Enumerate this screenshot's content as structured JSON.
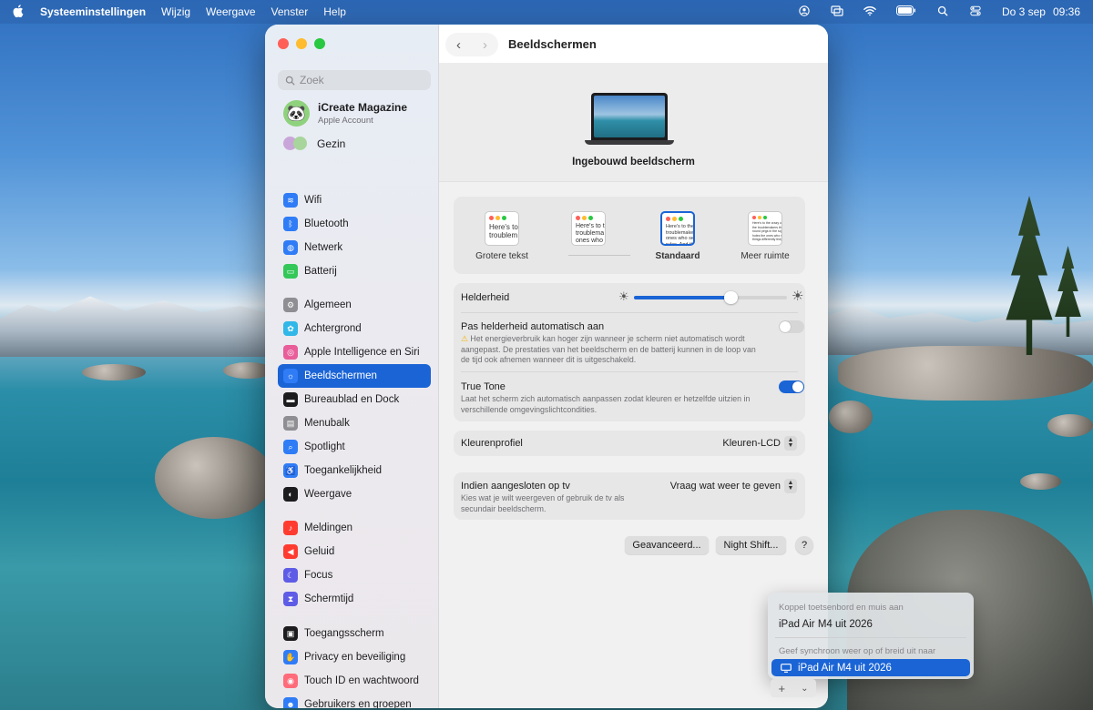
{
  "menubar": {
    "app": "Systeeminstellingen",
    "menus": [
      "Wijzig",
      "Weergave",
      "Venster",
      "Help"
    ],
    "date": "Do 3 sep",
    "time": "09:36"
  },
  "sidebar": {
    "search_placeholder": "Zoek",
    "account": {
      "name": "iCreate Magazine",
      "subtitle": "Apple Account"
    },
    "family": "Gezin",
    "groups": [
      [
        {
          "label": "Wifi",
          "icon": "wifi-icon",
          "color": "#2f7cf6"
        },
        {
          "label": "Bluetooth",
          "icon": "bluetooth-icon",
          "color": "#2f7cf6"
        },
        {
          "label": "Netwerk",
          "icon": "globe-icon",
          "color": "#2f7cf6"
        },
        {
          "label": "Batterij",
          "icon": "battery-icon",
          "color": "#34c759"
        }
      ],
      [
        {
          "label": "Algemeen",
          "icon": "gear-icon",
          "color": "#8e8e93"
        },
        {
          "label": "Achtergrond",
          "icon": "wallpaper-icon",
          "color": "#31b7e8"
        },
        {
          "label": "Apple Intelligence en Siri",
          "icon": "siri-icon",
          "color": "#e85d9a"
        },
        {
          "label": "Beeldschermen",
          "icon": "display-icon",
          "color": "#2f7cf6"
        },
        {
          "label": "Bureaublad en Dock",
          "icon": "dock-icon",
          "color": "#1c1c1e"
        },
        {
          "label": "Menubalk",
          "icon": "menubar-icon",
          "color": "#8e8e93"
        },
        {
          "label": "Spotlight",
          "icon": "search-icon",
          "color": "#2f7cf6"
        },
        {
          "label": "Toegankelijkheid",
          "icon": "accessibility-icon",
          "color": "#2f7cf6"
        },
        {
          "label": "Weergave",
          "icon": "appearance-icon",
          "color": "#1c1c1e"
        }
      ],
      [
        {
          "label": "Meldingen",
          "icon": "bell-icon",
          "color": "#ff3b30"
        },
        {
          "label": "Geluid",
          "icon": "speaker-icon",
          "color": "#ff3b30"
        },
        {
          "label": "Focus",
          "icon": "moon-icon",
          "color": "#5e5ce6"
        },
        {
          "label": "Schermtijd",
          "icon": "hourglass-icon",
          "color": "#5e5ce6"
        }
      ],
      [
        {
          "label": "Toegangsscherm",
          "icon": "lock-icon",
          "color": "#1c1c1e"
        },
        {
          "label": "Privacy en beveiliging",
          "icon": "hand-icon",
          "color": "#2f7cf6"
        },
        {
          "label": "Touch ID en wachtwoord",
          "icon": "fingerprint-icon",
          "color": "#ff6b7a"
        },
        {
          "label": "Gebruikers en groepen",
          "icon": "users-icon",
          "color": "#2f7cf6"
        }
      ]
    ],
    "selected": "Beeldschermen"
  },
  "main": {
    "title": "Beeldschermen",
    "display_name": "Ingebouwd beeldscherm",
    "resolution_options": [
      {
        "label": "Grotere tekst",
        "sample": "Here's to\ntroublem"
      },
      {
        "label": "",
        "sample": "Here's to t\ntroublema\nones who"
      },
      {
        "label": "Standaard",
        "sample": "Here's to the c\ntroublemakers\nones who see t\nrules. And the"
      },
      {
        "label": "Meer ruimte",
        "sample": "Here's to the crazy ones\nthe troublemakers the\nround pegs in the square\nholes the ones who see\nthings differently they're"
      }
    ],
    "selected_resolution": "Standaard",
    "brightness": {
      "label": "Helderheid",
      "value": 0.63
    },
    "auto_brightness": {
      "label": "Pas helderheid automatisch aan",
      "note": "Het energieverbruik kan hoger zijn wanneer je scherm niet automatisch wordt aangepast. De prestaties van het beeldscherm en de batterij kunnen in de loop van de tijd ook afnemen wanneer dit is uitgeschakeld.",
      "on": false
    },
    "true_tone": {
      "label": "True Tone",
      "note": "Laat het scherm zich automatisch aanpassen zodat kleuren er hetzelfde uitzien in verschillende omgevingslichtcondities.",
      "on": true
    },
    "color_profile": {
      "label": "Kleurenprofiel",
      "value": "Kleuren-LCD"
    },
    "tv": {
      "label": "Indien aangesloten op tv",
      "note": "Kies wat je wilt weergeven of gebruik de tv als secundair beeldscherm.",
      "value": "Vraag wat weer te geven"
    },
    "buttons": {
      "advanced": "Geavanceerd...",
      "night_shift": "Night Shift...",
      "help": "?"
    }
  },
  "popup": {
    "header1": "Koppel toetsenbord en muis aan",
    "item1": "iPad Air M4 uit 2026",
    "header2": "Geef synchroon weer op of breid uit naar",
    "item2": "iPad Air M4 uit 2026"
  },
  "addbar": {
    "plus": "+",
    "chevron": "⌄"
  },
  "colors": {
    "accent": "#1a64d6",
    "close": "#ff5f57",
    "minimize": "#febc2e",
    "zoom": "#28c840"
  }
}
